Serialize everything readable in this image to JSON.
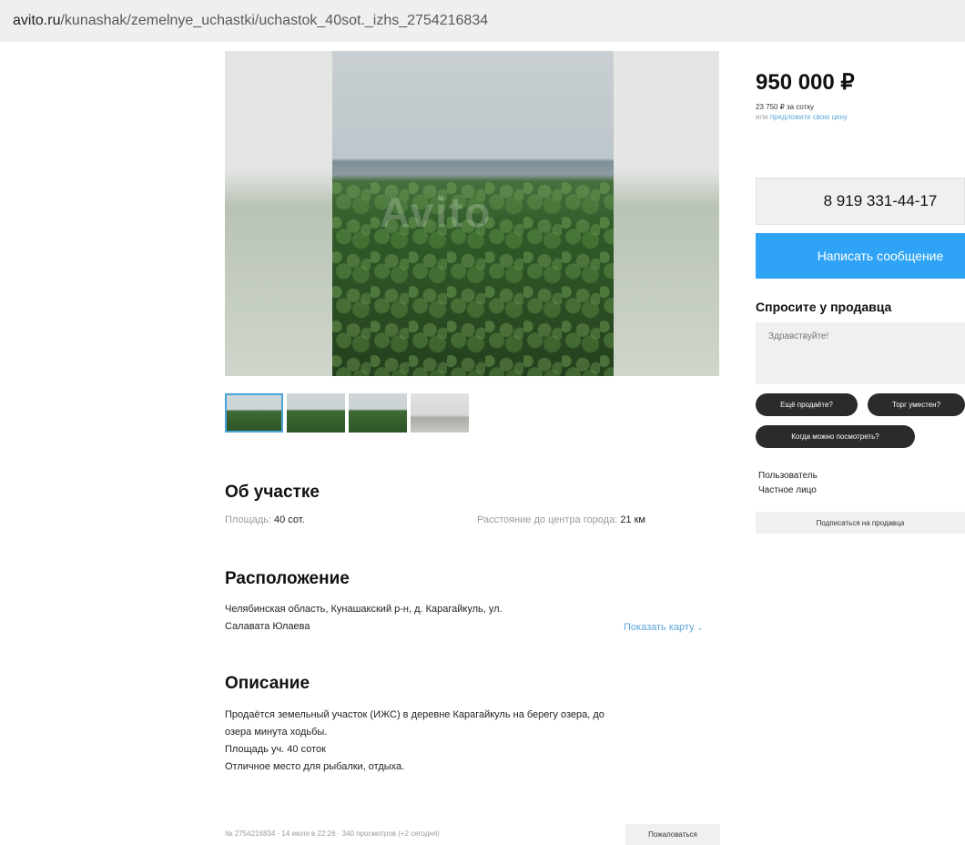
{
  "browser": {
    "url_domain": "avito.ru",
    "url_path": "/kunashak/zemelnye_uchastki/uchastok_40sot._izhs_2754216834"
  },
  "gallery": {
    "watermark": "Avito"
  },
  "about": {
    "title": "Об участке",
    "area_label": "Площадь:",
    "area_value": "40 сот.",
    "distance_label": "Расстояние до центра города:",
    "distance_value": "21 км"
  },
  "location": {
    "title": "Расположение",
    "address_line1": "Челябинская область, Кунашакский р-н, д. Карагайкуль, ул.",
    "address_line2": "Салавата Юлаева",
    "show_map": "Показать карту"
  },
  "description": {
    "title": "Описание",
    "line1": "Продаётся земельный участок (ИЖС) в деревне Карагайкуль на берегу озера, до",
    "line2": "озера минута ходьбы.",
    "line3": "Площадь уч. 40 соток",
    "line4": "Отличное место для рыбалки, отдыха."
  },
  "footer": {
    "meta": "№ 2754216834 · 14 июля в 22:26 · 340 просмотров (+2 сегодня)",
    "report": "Пожаловаться"
  },
  "sidebar": {
    "price": "950 000 ₽",
    "price_per": "23 750 ₽ за сотку",
    "offer_prefix": "или ",
    "offer_link": "предложите свою цену",
    "phone": "8 919 331-44-17",
    "message_button": "Написать сообщение",
    "ask_title": "Спросите у продавца",
    "ask_placeholder": "Здравствуйте!",
    "quick_questions": [
      "Ещё продаёте?",
      "Торг уместен?",
      "Когда можно посмотреть?"
    ],
    "seller_name": "Пользователь",
    "seller_type": "Частное лицо",
    "subscribe": "Подписаться на продавца"
  }
}
